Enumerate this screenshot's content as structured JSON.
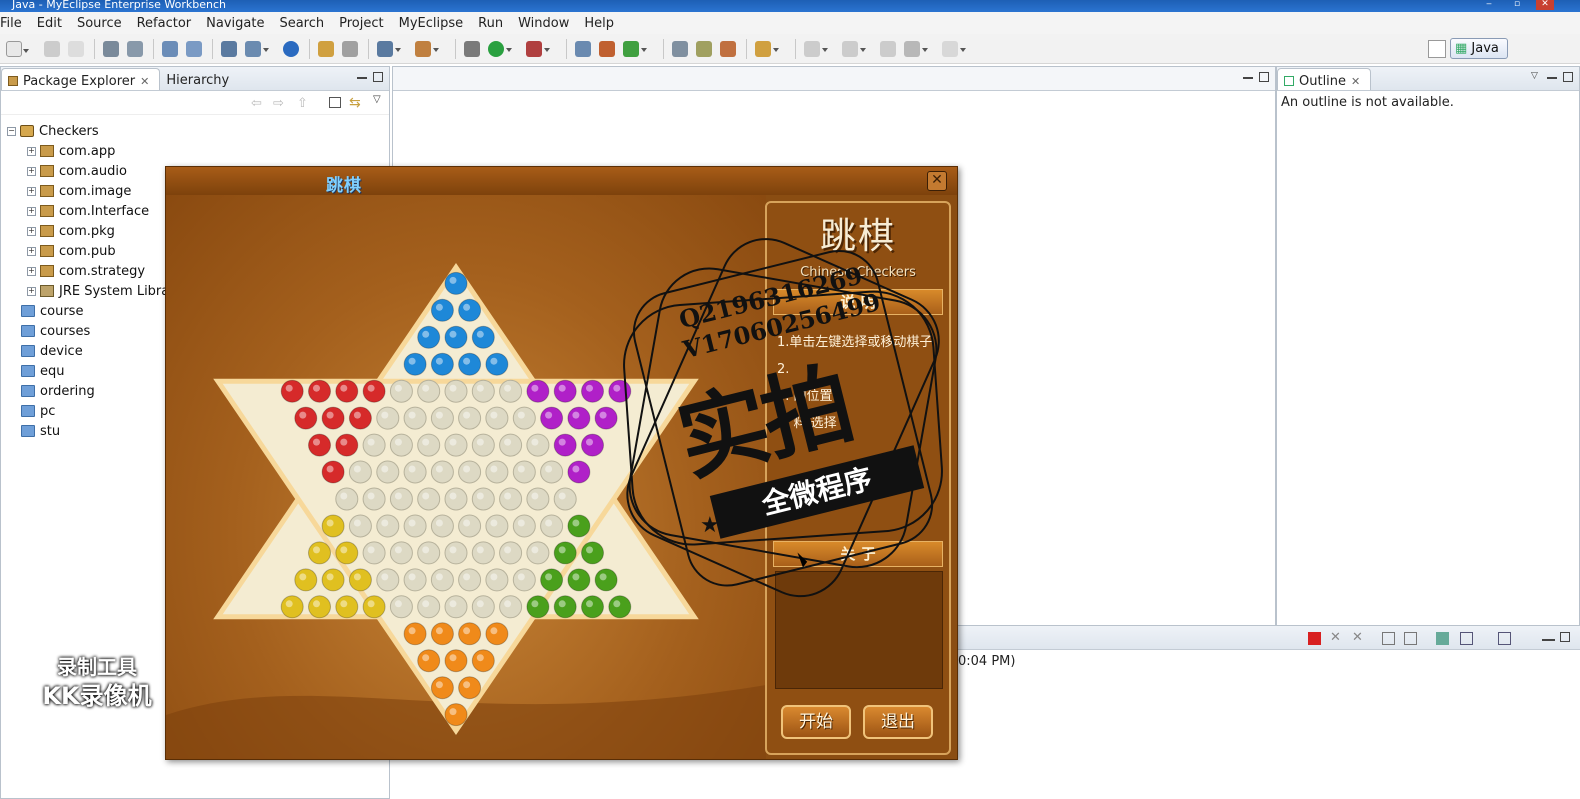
{
  "window": {
    "title": "Java - MyEclipse Enterprise Workbench"
  },
  "menubar": {
    "items": [
      "File",
      "Edit",
      "Source",
      "Refactor",
      "Navigate",
      "Search",
      "Project",
      "MyEclipse",
      "Run",
      "Window",
      "Help"
    ]
  },
  "perspective": {
    "label": "Java"
  },
  "package_explorer": {
    "tabs": [
      "Package Explorer",
      "Hierarchy"
    ],
    "tree": {
      "project": "Checkers",
      "packages": [
        "com.app",
        "com.audio",
        "com.image",
        "com.Interface",
        "com.pkg",
        "com.pub",
        "com.strategy"
      ],
      "library": "JRE System Library",
      "folders": [
        "course",
        "courses",
        "device",
        "equ",
        "ordering",
        "pc",
        "stu"
      ]
    }
  },
  "outline": {
    "tab": "Outline",
    "message": "An outline is not available."
  },
  "console": {
    "partial_time": "0:04 PM)"
  },
  "game": {
    "window_title": "跳棋",
    "logo_title": "跳棋",
    "logo_subtitle": "Chinese Checkers",
    "instructions_header": "说 明",
    "instructions": [
      "1.单击左键选择或移动棋子",
      "2.",
      "3.              的位置",
      "4.       料        选择"
    ],
    "about_header": "关 于",
    "start_button": "开始",
    "exit_button": "退出",
    "piece_colors": {
      "top": "#1e88d8",
      "upper_left": "#d62a2a",
      "upper_right": "#b020c8",
      "lower_left": "#e0c020",
      "lower_right": "#4aa01c",
      "bottom": "#f08a1a",
      "center": "#ddd9c4"
    }
  },
  "watermarks": {
    "qq_line1": "Q2196316269",
    "qq_line2": "V17060256499",
    "big_text": "实拍",
    "banner": "全微程序",
    "recorder_line1": "录制工具",
    "recorder_line2": "KK录像机"
  }
}
